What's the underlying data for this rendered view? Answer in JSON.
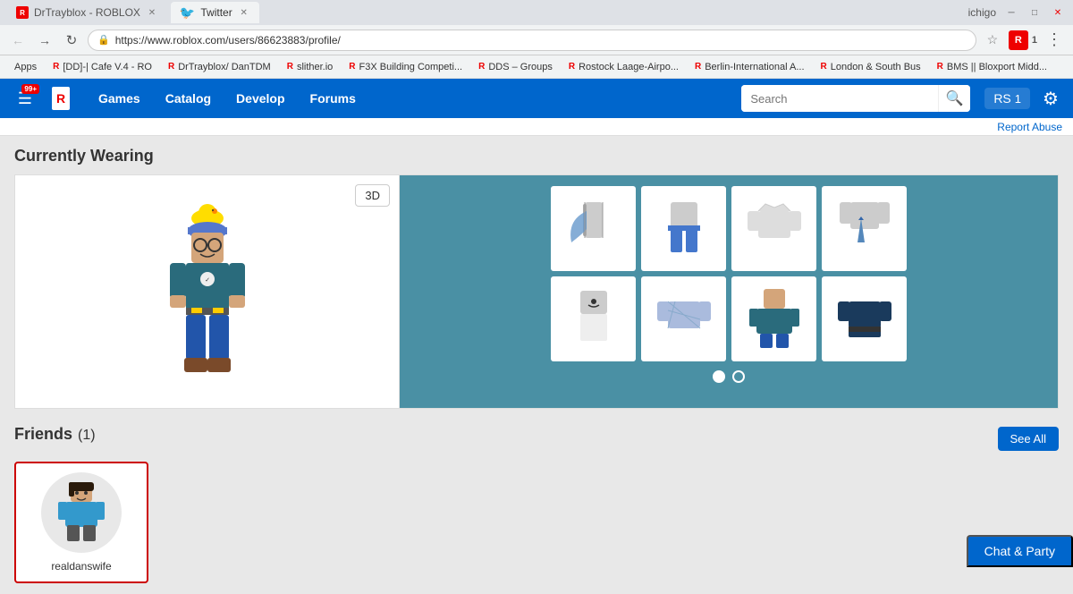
{
  "browser": {
    "tabs": [
      {
        "id": "roblox-tab",
        "label": "DrTrayblox - ROBLOX",
        "active": false,
        "favicon": "roblox"
      },
      {
        "id": "twitter-tab",
        "label": "Twitter",
        "active": true,
        "favicon": "twitter"
      }
    ],
    "user": "ichigo",
    "url": "https://www.roblox.com/users/86623883/profile/",
    "window_controls": [
      "minimize",
      "maximize",
      "close"
    ]
  },
  "bookmarks": [
    {
      "label": "Apps"
    },
    {
      "label": "[DD]-| Cafe V.4 - RO"
    },
    {
      "label": "DrTrayblox/ DanTDM"
    },
    {
      "label": "slither.io"
    },
    {
      "label": "F3X Building Competi..."
    },
    {
      "label": "DDS – Groups"
    },
    {
      "label": "Rostock Laage-Airpo..."
    },
    {
      "label": "Berlin-International A..."
    },
    {
      "label": "London & South Bus"
    },
    {
      "label": "BMS || Bloxport Midd..."
    }
  ],
  "navbar": {
    "notification_count": "99+",
    "links": [
      "Games",
      "Catalog",
      "Develop",
      "Forums"
    ],
    "search_placeholder": "Search",
    "robux": "1",
    "settings_label": "⚙"
  },
  "report_abuse": "Report Abuse",
  "currently_wearing": {
    "title": "Currently Wearing",
    "button_3d": "3D",
    "dots": [
      {
        "active": true
      },
      {
        "active": false
      }
    ]
  },
  "friends": {
    "title": "Friends",
    "count": "(1)",
    "see_all": "See All",
    "items": [
      {
        "name": "realdanswife"
      }
    ]
  },
  "chat_party": "Chat & Party"
}
